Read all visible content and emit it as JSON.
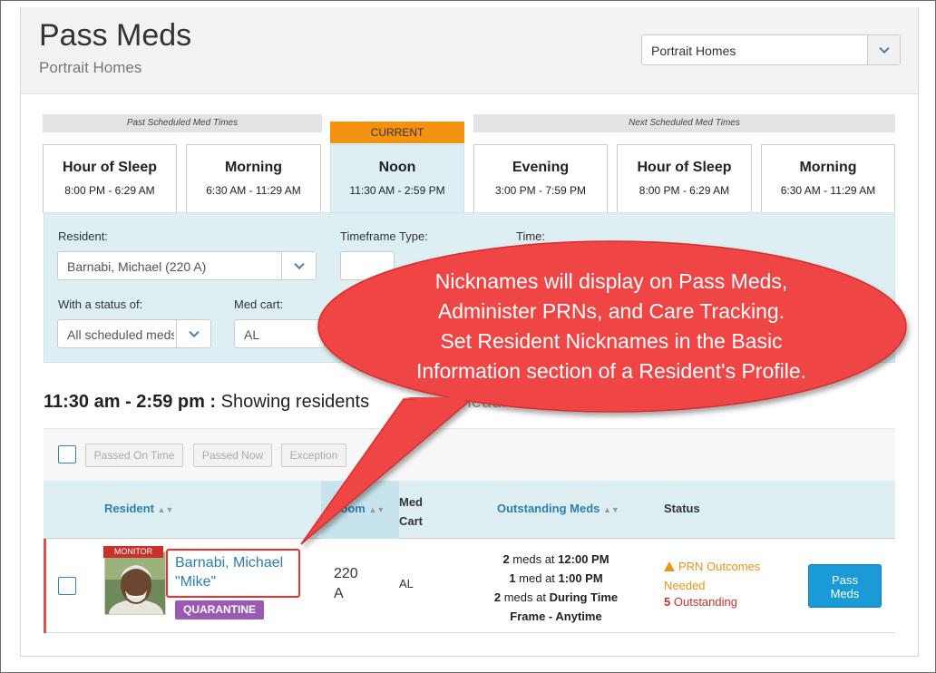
{
  "header": {
    "title": "Pass Meds",
    "subtitle": "Portrait Homes",
    "community_select": "Portrait Homes"
  },
  "timeline": {
    "past_label": "Past Scheduled Med Times",
    "current_label": "CURRENT",
    "next_label": "Next Scheduled Med Times",
    "slots": [
      {
        "name": "Hour of Sleep",
        "range": "8:00 PM - 6:29 AM"
      },
      {
        "name": "Morning",
        "range": "6:30 AM - 11:29 AM"
      },
      {
        "name": "Noon",
        "range": "11:30 AM - 2:59 PM"
      },
      {
        "name": "Evening",
        "range": "3:00 PM - 7:59 PM"
      },
      {
        "name": "Hour of Sleep",
        "range": "8:00 PM - 6:29 AM"
      },
      {
        "name": "Morning",
        "range": "6:30 AM - 11:29 AM"
      }
    ]
  },
  "filters": {
    "resident_label": "Resident:",
    "resident_value": "Barnabi, Michael (220 A)",
    "timeframe_label": "Timeframe Type:",
    "time_label": "Time:",
    "status_label": "With a status of:",
    "status_value": "All scheduled meds",
    "medcart_label": "Med cart:",
    "medcart_value": "AL"
  },
  "showing": {
    "range": "11:30 am - 2:59 pm :",
    "text_a": "Showing residents",
    "text_b": "scheduled meds"
  },
  "toolbar": {
    "passed_on_time": "Passed On Time",
    "passed_now": "Passed Now",
    "exception": "Exception"
  },
  "table": {
    "col_resident": "Resident",
    "col_room": "Room",
    "col_medcart_1": "Med",
    "col_medcart_2": "Cart",
    "col_outstanding": "Outstanding Meds",
    "col_status": "Status",
    "row": {
      "monitor": "MONITOR",
      "name_line1": "Barnabi, Michael",
      "name_line2": "\"Mike\"",
      "quarantine": "QUARANTINE",
      "room_line1": "220",
      "room_line2": "A",
      "cart": "AL",
      "meds": [
        {
          "count": "2",
          "mid": "meds at",
          "time": "12:00 PM"
        },
        {
          "count": "1",
          "mid": "med at",
          "time": "1:00 PM"
        },
        {
          "count": "2",
          "mid": "meds at",
          "time": "During Time"
        },
        {
          "count": "",
          "mid": "",
          "time": "Frame - Anytime"
        }
      ],
      "status_line1": "PRN Outcomes",
      "status_line2": "Needed",
      "outstanding_count": "5",
      "outstanding_text": "Outstanding",
      "pass_button_1": "Pass",
      "pass_button_2": "Meds"
    }
  },
  "callout": {
    "lines": [
      "Nicknames will display on Pass Meds,",
      "Administer PRNs, and Care Tracking.",
      "Set Resident Nicknames in the Basic",
      "Information section of a Resident's Profile."
    ],
    "color": "#f04040"
  },
  "colors": {
    "accent": "#2a7fb0",
    "current": "#f39211",
    "panel": "#ddeff3",
    "danger": "#c9302c",
    "quarantine": "#9b59b6",
    "button": "#1a9ad6"
  }
}
